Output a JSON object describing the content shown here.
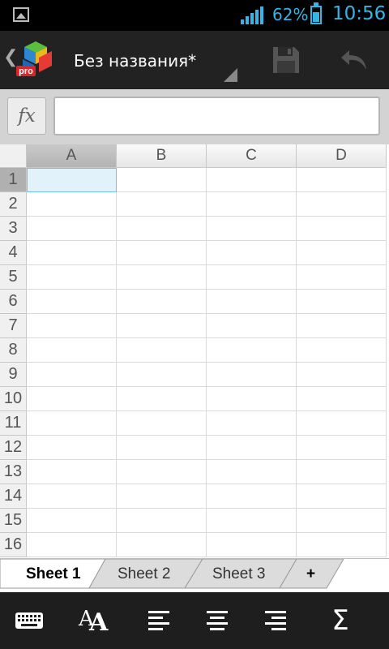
{
  "status_bar": {
    "battery_percent": "62%",
    "time": "10:56",
    "accent_color": "#33b5e5",
    "icons": [
      "picture-notification-icon",
      "signal-strength-icon",
      "battery-icon"
    ]
  },
  "action_bar": {
    "app_logo_text": "pro",
    "document_title": "Без названия*",
    "icons": [
      "back-chevron-icon",
      "office-suite-logo",
      "save-icon",
      "undo-icon"
    ]
  },
  "formula_bar": {
    "fx_label": "fx",
    "value": ""
  },
  "sheet": {
    "columns": [
      "A",
      "B",
      "C",
      "D"
    ],
    "rows": [
      "1",
      "2",
      "3",
      "4",
      "5",
      "6",
      "7",
      "8",
      "9",
      "10",
      "11",
      "12",
      "13",
      "14",
      "15",
      "16"
    ],
    "selected_cell": "A1"
  },
  "tabs": [
    {
      "label": "Sheet 1",
      "active": true
    },
    {
      "label": "Sheet 2",
      "active": false
    },
    {
      "label": "Sheet 3",
      "active": false
    }
  ],
  "add_sheet_label": "+",
  "toolbar": {
    "font_size_glyph": "A",
    "sum_glyph": "Σ",
    "icons": [
      "keyboard-icon",
      "font-size-icon",
      "align-left-icon",
      "align-center-icon",
      "align-right-icon",
      "autosum-icon"
    ]
  }
}
